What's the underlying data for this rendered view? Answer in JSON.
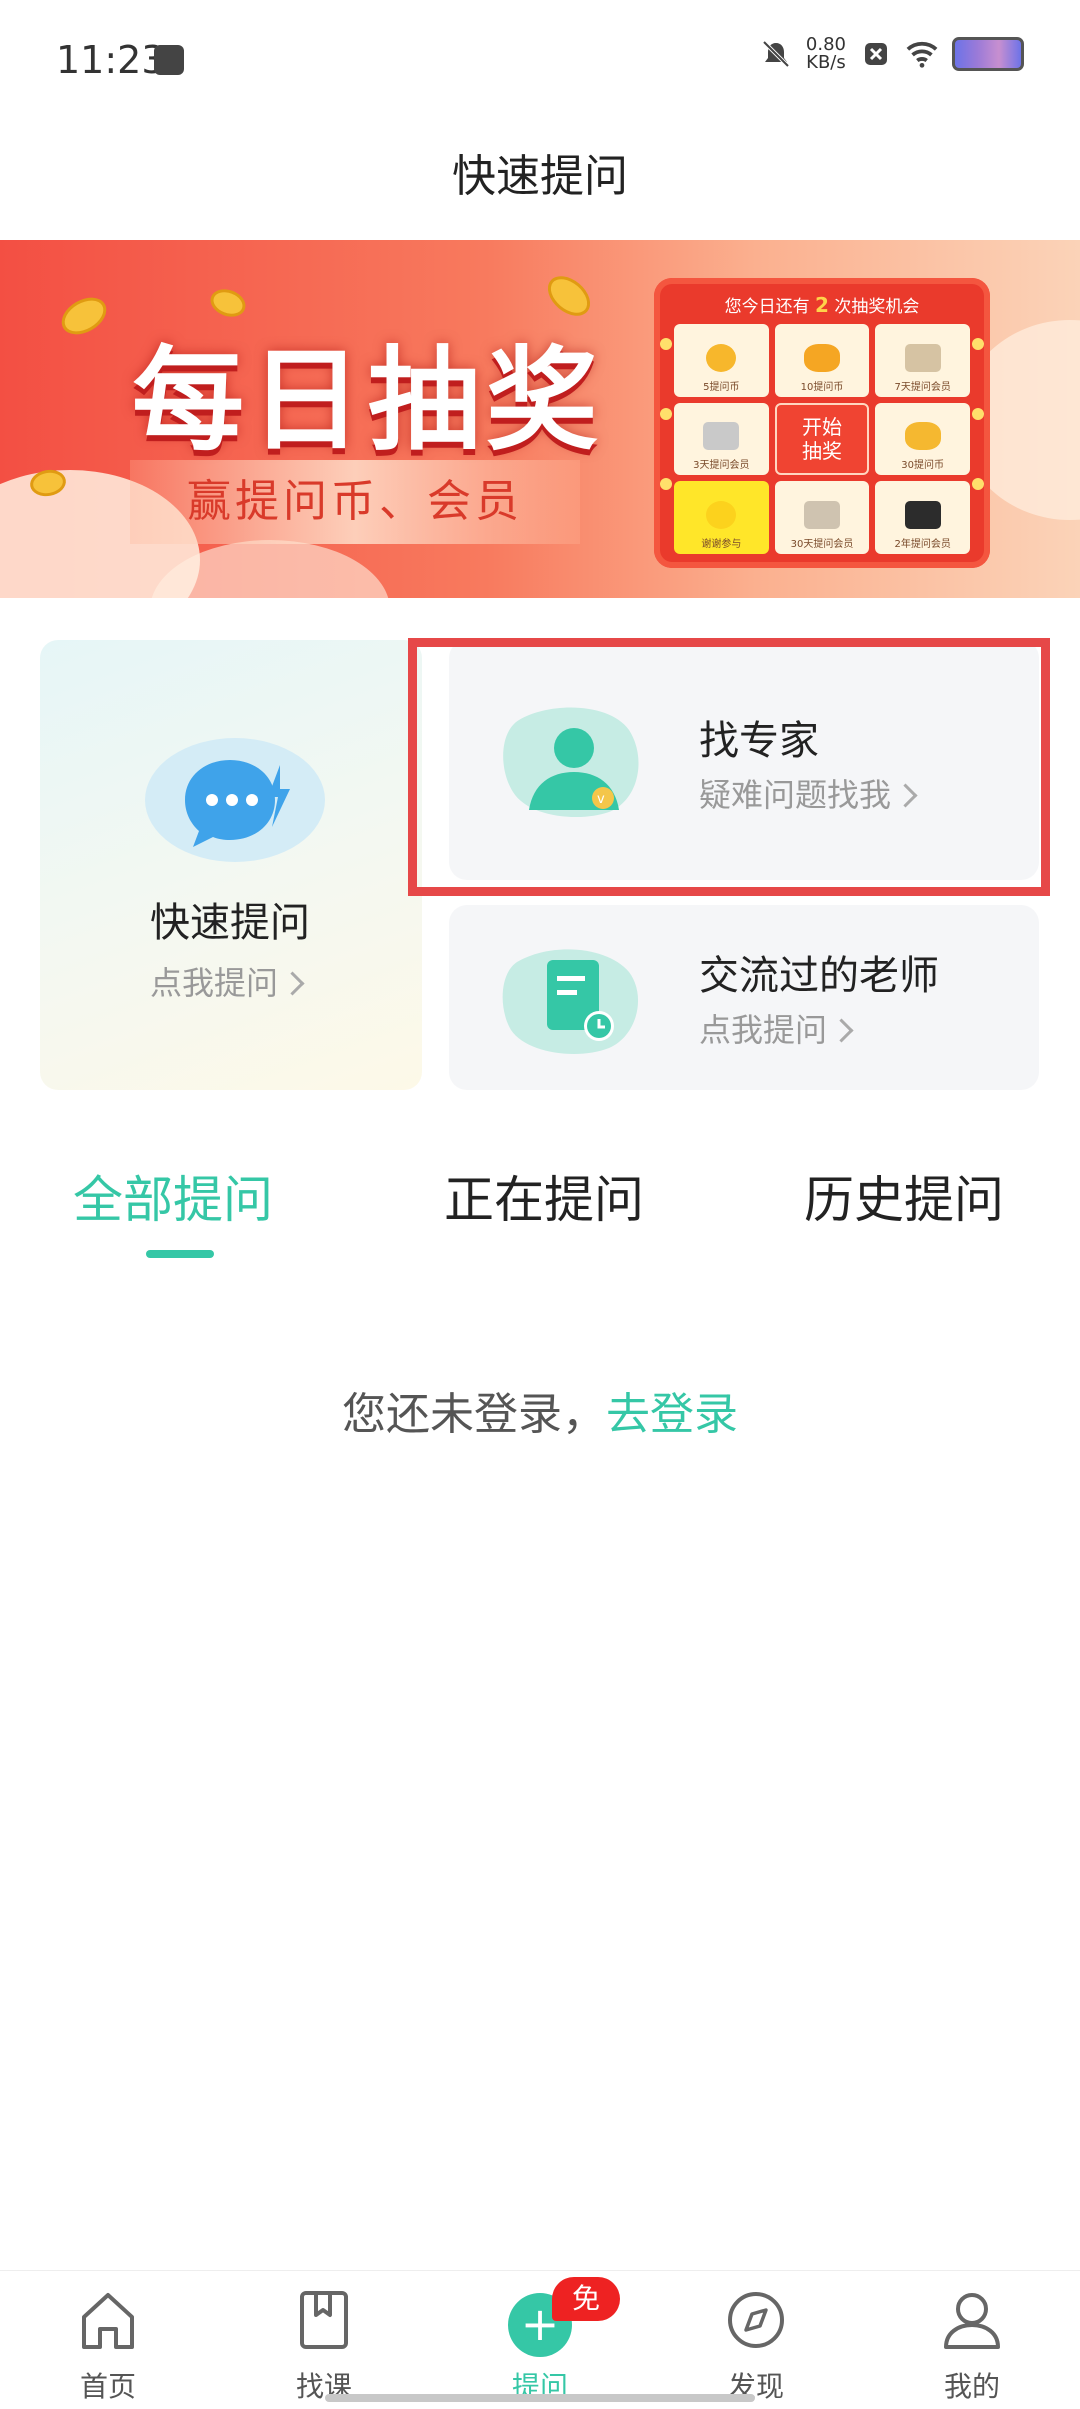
{
  "status_bar": {
    "time": "11:23",
    "net_speed_value": "0.80",
    "net_speed_unit": "KB/s",
    "icons": [
      "bag-icon",
      "mute-bell-icon",
      "close-box-icon",
      "wifi-icon",
      "battery-icon"
    ]
  },
  "header": {
    "title": "快速提问"
  },
  "banner": {
    "title": "每日抽奖",
    "subtitle": "赢提问币、会员",
    "lottery": {
      "head_prefix": "您今日还有",
      "head_count": "2",
      "head_suffix": "次抽奖机会",
      "cells": [
        "5提问币",
        "10提问币",
        "7天提问会员",
        "3天提问会员",
        "开始抽奖",
        "30提问币",
        "谢谢参与",
        "30天提问会员",
        "2年提问会员"
      ]
    }
  },
  "cards": {
    "quick": {
      "title": "快速提问",
      "sub": "点我提问"
    },
    "expert": {
      "title": "找专家",
      "sub": "疑难问题找我"
    },
    "teacher": {
      "title": "交流过的老师",
      "sub": "点我提问"
    }
  },
  "tabs": [
    {
      "label": "全部提问",
      "active": true
    },
    {
      "label": "正在提问",
      "active": false
    },
    {
      "label": "历史提问",
      "active": false
    }
  ],
  "empty_state": {
    "text": "您还未登录，",
    "link": "去登录"
  },
  "bottom_nav": [
    {
      "label": "首页",
      "icon": "home-icon"
    },
    {
      "label": "找课",
      "icon": "book-icon"
    },
    {
      "label": "提问",
      "icon": "plus-icon",
      "active": true,
      "badge": "免费"
    },
    {
      "label": "发现",
      "icon": "compass-icon"
    },
    {
      "label": "我的",
      "icon": "user-icon"
    }
  ],
  "colors": {
    "accent": "#35c7a6",
    "highlight_border": "#e64848",
    "badge": "#ee2222",
    "banner_red": "#f34f43"
  }
}
